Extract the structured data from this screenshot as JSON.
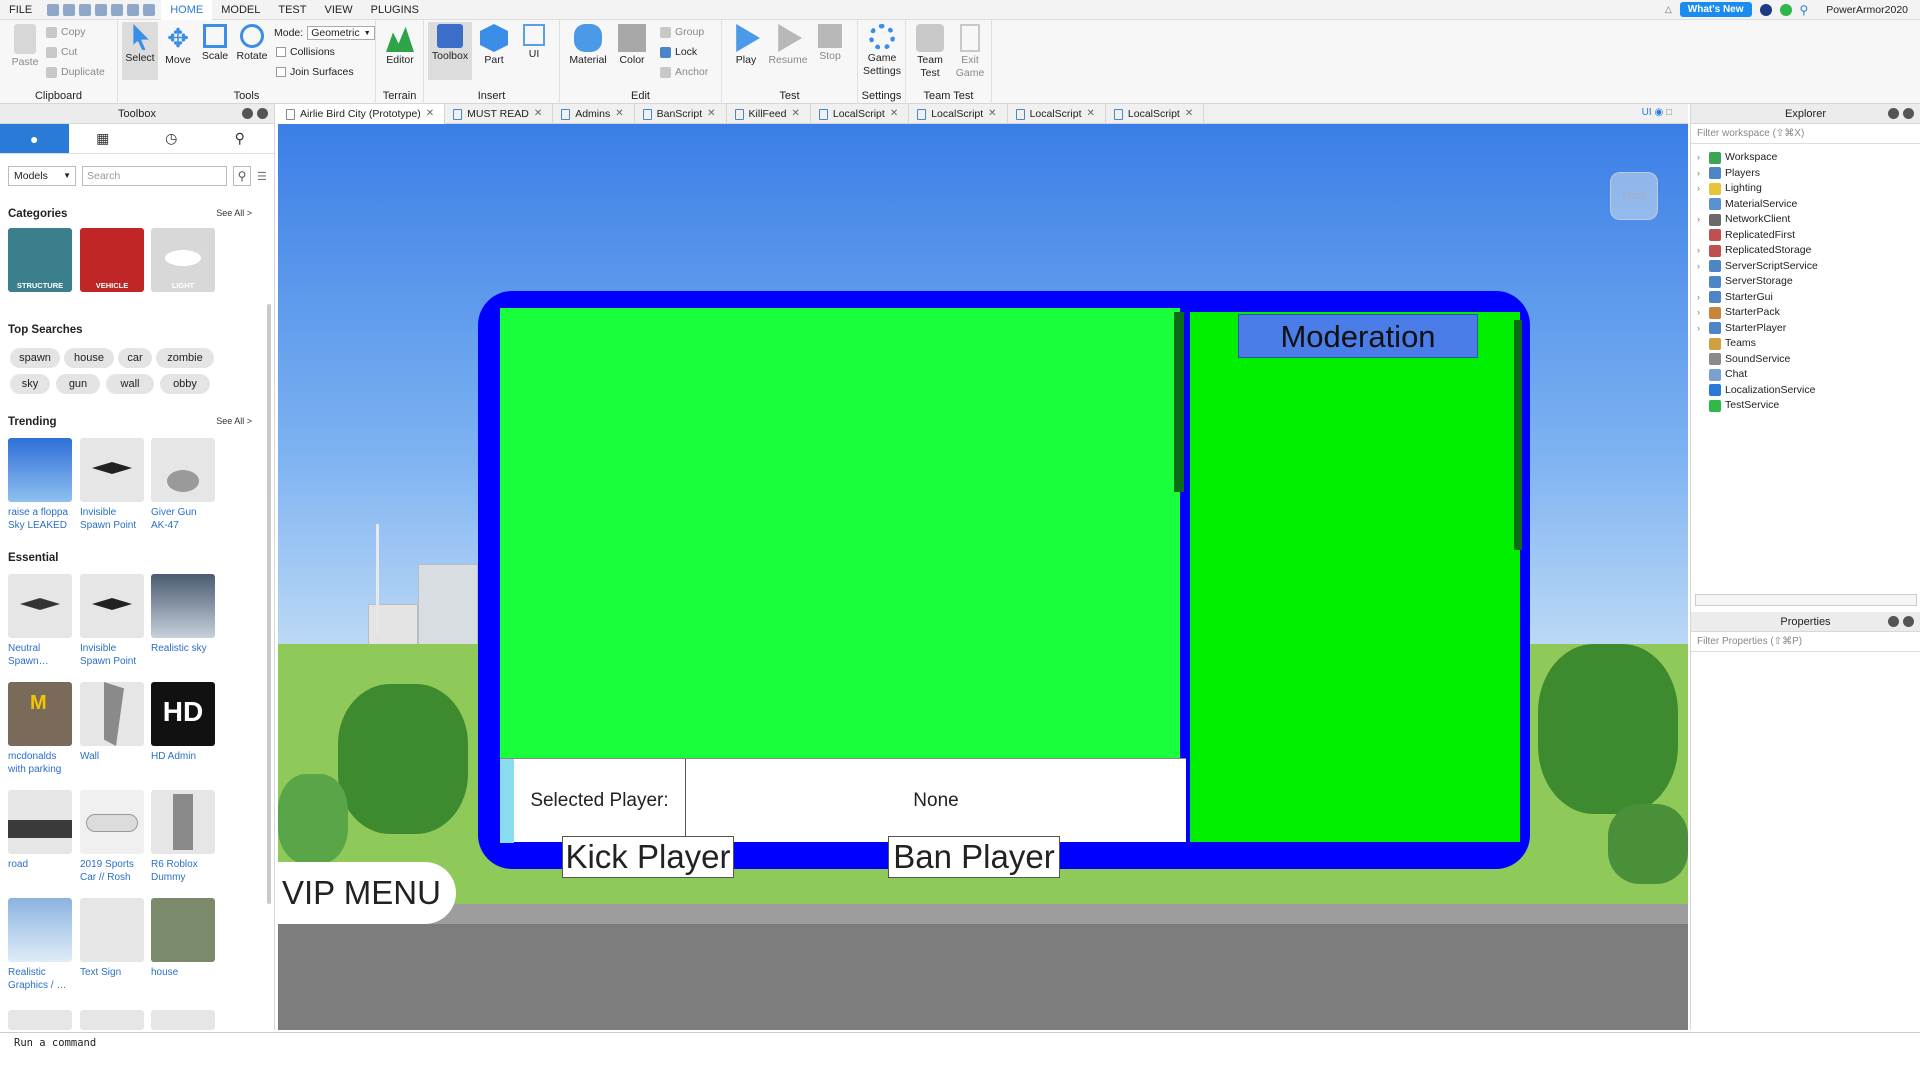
{
  "menu": {
    "tabs": [
      "FILE",
      "HOME",
      "MODEL",
      "TEST",
      "VIEW",
      "PLUGINS"
    ],
    "active": "HOME",
    "whats_new": "What's New",
    "username": "PowerArmor2020"
  },
  "ribbon": {
    "clipboard": {
      "paste": "Paste",
      "copy": "Copy",
      "cut": "Cut",
      "duplicate": "Duplicate",
      "label": "Clipboard"
    },
    "tools": {
      "select": "Select",
      "move": "Move",
      "scale": "Scale",
      "rotate": "Rotate",
      "mode_label": "Mode:",
      "mode_value": "Geometric",
      "collisions": "Collisions",
      "join_surfaces": "Join Surfaces",
      "label": "Tools"
    },
    "terrain": {
      "editor": "Editor",
      "label": "Terrain"
    },
    "insert": {
      "toolbox": "Toolbox",
      "part": "Part",
      "ui": "UI",
      "label": "Insert"
    },
    "edit": {
      "material": "Material",
      "color": "Color",
      "group": "Group",
      "lock": "Lock",
      "anchor": "Anchor",
      "label": "Edit"
    },
    "test": {
      "play": "Play",
      "resume": "Resume",
      "stop": "Stop",
      "label": "Test"
    },
    "settings": {
      "game_settings_line1": "Game",
      "game_settings_line2": "Settings",
      "label": "Settings"
    },
    "team_test": {
      "team_test_line1": "Team",
      "team_test_line2": "Test",
      "exit_line1": "Exit",
      "exit_line2": "Game",
      "label": "Team Test"
    }
  },
  "toolbox": {
    "title": "Toolbox",
    "category_select": "Models",
    "search_placeholder": "Search",
    "categories_title": "Categories",
    "see_all": "See All >",
    "categories": [
      "STRUCTURE",
      "VEHICLE",
      "LIGHT"
    ],
    "top_searches_title": "Top Searches",
    "top_searches": [
      "spawn",
      "house",
      "car",
      "zombie",
      "sky",
      "gun",
      "wall",
      "obby"
    ],
    "trending_title": "Trending",
    "trending": [
      {
        "l1": "raise a floppa",
        "l2": "Sky LEAKED"
      },
      {
        "l1": "Invisible",
        "l2": "Spawn Point"
      },
      {
        "l1": "Giver Gun",
        "l2": "AK-47"
      }
    ],
    "essential_title": "Essential",
    "essential": [
      {
        "l1": "Neutral",
        "l2": "Spawn…"
      },
      {
        "l1": "Invisible",
        "l2": "Spawn Point"
      },
      {
        "l1": "Realistic sky",
        "l2": ""
      },
      {
        "l1": "mcdonalds",
        "l2": "with parking"
      },
      {
        "l1": "Wall",
        "l2": ""
      },
      {
        "l1": "HD Admin",
        "l2": ""
      },
      {
        "l1": "road",
        "l2": ""
      },
      {
        "l1": "2019 Sports",
        "l2": "Car // Rosh"
      },
      {
        "l1": "R6 Roblox",
        "l2": "Dummy"
      },
      {
        "l1": "Realistic",
        "l2": "Graphics / …"
      },
      {
        "l1": "Text Sign",
        "l2": ""
      },
      {
        "l1": "house",
        "l2": ""
      }
    ],
    "hd_text": "HD"
  },
  "doc_tabs": [
    "Airlie Bird City (Prototype)",
    "MUST READ",
    "Admins",
    "BanScript",
    "KillFeed",
    "LocalScript",
    "LocalScript",
    "LocalScript",
    "LocalScript"
  ],
  "viewport": {
    "front": "Front",
    "ui_toggle": "UI",
    "moderation_title": "Moderation",
    "selected_player_label": "Selected Player:",
    "selected_player_value": "None",
    "kick_button": "Kick Player",
    "ban_button": "Ban Player",
    "vip_menu": "VIP MENU"
  },
  "explorer": {
    "title": "Explorer",
    "filter_placeholder": "Filter workspace (⇧⌘X)",
    "items": [
      {
        "name": "Workspace",
        "expand": true,
        "color": "#3aa655"
      },
      {
        "name": "Players",
        "expand": true,
        "color": "#4d86c7"
      },
      {
        "name": "Lighting",
        "expand": true,
        "color": "#e8c43a"
      },
      {
        "name": "MaterialService",
        "expand": false,
        "color": "#5a8fd0"
      },
      {
        "name": "NetworkClient",
        "expand": true,
        "color": "#6a6a6a"
      },
      {
        "name": "ReplicatedFirst",
        "expand": false,
        "color": "#c05050"
      },
      {
        "name": "ReplicatedStorage",
        "expand": true,
        "color": "#c05050"
      },
      {
        "name": "ServerScriptService",
        "expand": true,
        "color": "#4d86c7"
      },
      {
        "name": "ServerStorage",
        "expand": false,
        "color": "#4d86c7"
      },
      {
        "name": "StarterGui",
        "expand": true,
        "color": "#4d86c7"
      },
      {
        "name": "StarterPack",
        "expand": true,
        "color": "#c8843a"
      },
      {
        "name": "StarterPlayer",
        "expand": true,
        "color": "#4d86c7"
      },
      {
        "name": "Teams",
        "expand": false,
        "color": "#d0a040"
      },
      {
        "name": "SoundService",
        "expand": false,
        "color": "#8a8a8a"
      },
      {
        "name": "Chat",
        "expand": false,
        "color": "#7aa0d0"
      },
      {
        "name": "LocalizationService",
        "expand": false,
        "color": "#2a7bd8"
      },
      {
        "name": "TestService",
        "expand": false,
        "color": "#2fb84a"
      }
    ]
  },
  "properties": {
    "title": "Properties",
    "filter_placeholder": "Filter Properties (⇧⌘P)"
  },
  "command_bar": {
    "placeholder": "Run a command"
  }
}
